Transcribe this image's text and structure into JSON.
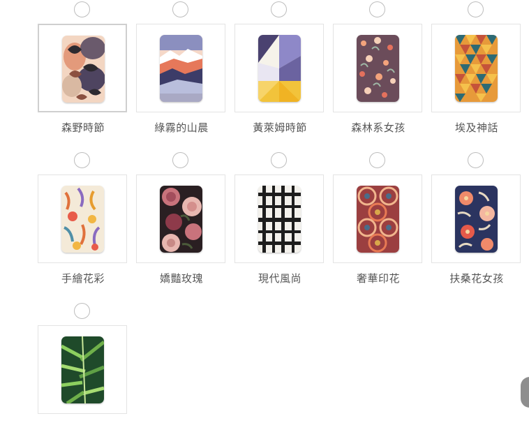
{
  "designs": [
    {
      "label": "森野時節",
      "selected": true,
      "pattern": "forest-leaves"
    },
    {
      "label": "綠霧的山晨",
      "selected": false,
      "pattern": "misty-mountains"
    },
    {
      "label": "黃萊姆時節",
      "selected": false,
      "pattern": "lime-geometric"
    },
    {
      "label": "森林系女孩",
      "selected": false,
      "pattern": "forest-girl-berries"
    },
    {
      "label": "埃及神話",
      "selected": false,
      "pattern": "egypt-triangles"
    },
    {
      "label": "手繪花彩",
      "selected": false,
      "pattern": "handdrawn-flowers"
    },
    {
      "label": "嬌豔玫瑰",
      "selected": false,
      "pattern": "roses"
    },
    {
      "label": "現代風尚",
      "selected": false,
      "pattern": "modern-grid"
    },
    {
      "label": "奢華印花",
      "selected": false,
      "pattern": "luxury-print"
    },
    {
      "label": "扶桑花女孩",
      "selected": false,
      "pattern": "hibiscus"
    },
    {
      "label": "",
      "selected": false,
      "pattern": "palm-leaves"
    }
  ]
}
